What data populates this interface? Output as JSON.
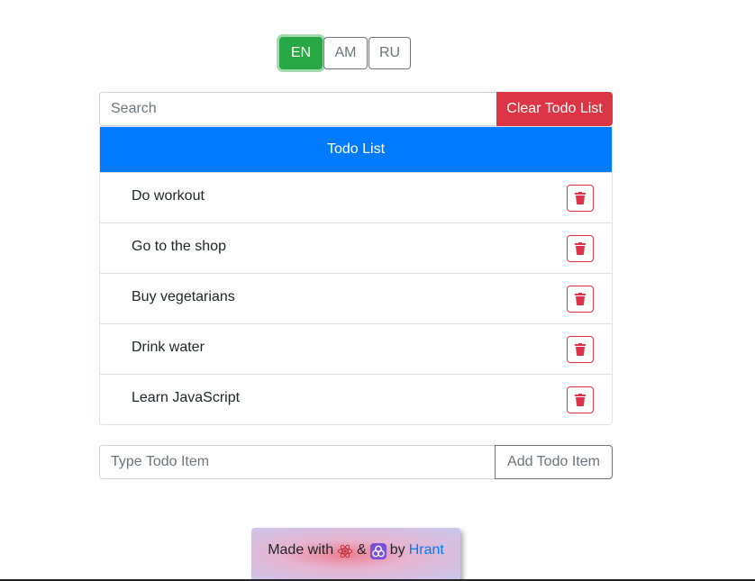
{
  "languages": {
    "items": [
      "EN",
      "AM",
      "RU"
    ],
    "active": "EN",
    "active_color": "#28a745"
  },
  "search": {
    "placeholder": "Search",
    "clear_label": "Clear Todo List",
    "clear_color": "#dc3545"
  },
  "todo": {
    "header": "Todo List",
    "header_color": "#007bff",
    "items": [
      "Do workout",
      "Go to the shop",
      "Buy vegetarians",
      "Drink water",
      "Learn JavaScript"
    ],
    "delete_icon": "trash-icon"
  },
  "add": {
    "placeholder": "Type Todo Item",
    "button_label": "Add Todo Item"
  },
  "footer": {
    "made_with": "Made with",
    "amp": "&",
    "by": "by",
    "author": "Hrant",
    "icons": [
      "react-icon",
      "redux-icon"
    ]
  }
}
